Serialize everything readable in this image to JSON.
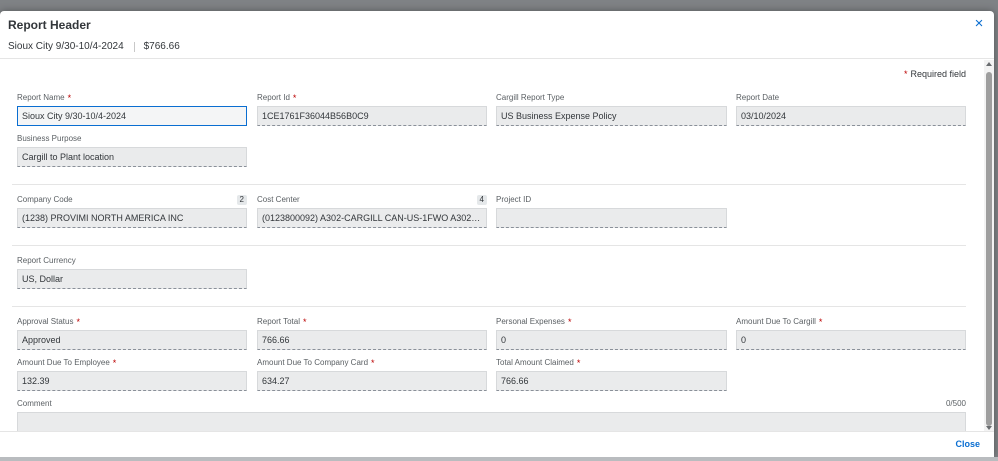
{
  "dialog": {
    "title": "Report Header",
    "subtitle_name": "Sioux City 9/30-10/4-2024",
    "subtitle_amount": "$766.66",
    "required_note": "Required field",
    "required_star": "*",
    "close_label": "Close",
    "close_icon": "×"
  },
  "fields": {
    "report_name": {
      "label": "Report Name",
      "value": "Sioux City 9/30-10/4-2024",
      "required": "*"
    },
    "report_id": {
      "label": "Report Id",
      "value": "1CE1761F36044B56B0C9",
      "required": "*"
    },
    "report_type": {
      "label": "Cargill Report Type",
      "value": "US Business Expense Policy"
    },
    "report_date": {
      "label": "Report Date",
      "value": "03/10/2024"
    },
    "business_purpose": {
      "label": "Business Purpose",
      "value": "Cargill to Plant location"
    },
    "company_code": {
      "label": "Company Code",
      "value": "(1238) PROVIMI NORTH AMERICA INC",
      "badge": "2"
    },
    "cost_center": {
      "label": "Cost Center",
      "value": "(0123800092) A302-CARGILL CAN-US-1FWO A302 P...",
      "badge": "4"
    },
    "project_id": {
      "label": "Project ID",
      "value": ""
    },
    "report_currency": {
      "label": "Report Currency",
      "value": "US, Dollar"
    },
    "approval_status": {
      "label": "Approval Status",
      "value": "Approved",
      "required": "*"
    },
    "report_total": {
      "label": "Report Total",
      "value": "766.66",
      "required": "*"
    },
    "personal_expenses": {
      "label": "Personal Expenses",
      "value": "0",
      "required": "*"
    },
    "amount_due_cargill": {
      "label": "Amount Due To Cargill",
      "value": "0",
      "required": "*"
    },
    "amount_due_employee": {
      "label": "Amount Due To Employee",
      "value": "132.39",
      "required": "*"
    },
    "amount_due_card": {
      "label": "Amount Due To Company Card",
      "value": "634.27",
      "required": "*"
    },
    "total_claimed": {
      "label": "Total Amount Claimed",
      "value": "766.66",
      "required": "*"
    },
    "comment": {
      "label": "Comment",
      "value": "",
      "counter": "0/500"
    }
  },
  "colors": {
    "accent": "#0a6ed1",
    "required": "#bb0000",
    "input_bg": "#eaebec"
  }
}
